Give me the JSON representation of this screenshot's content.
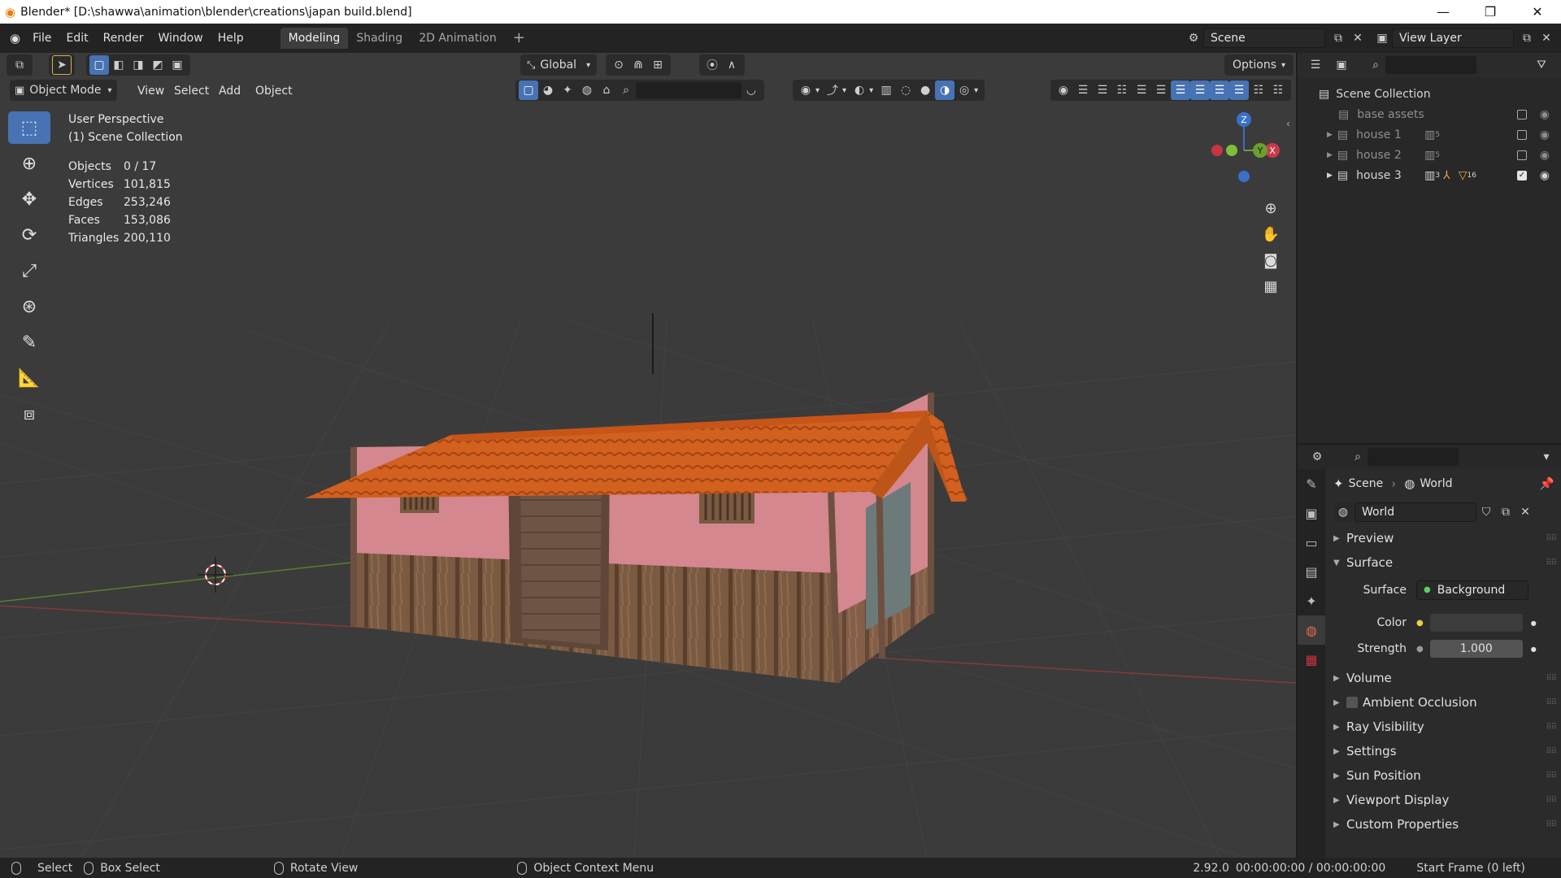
{
  "window": {
    "title": "Blender* [D:\\shawwa\\animation\\blender\\creations\\japan build.blend]",
    "minimize": "—",
    "restore": "❐",
    "close": "✕"
  },
  "menu": [
    "File",
    "Edit",
    "Render",
    "Window",
    "Help"
  ],
  "workspaces": [
    "Modeling",
    "Shading",
    "2D Animation"
  ],
  "workspace_add": "+",
  "scene_name": "Scene",
  "view_layer": "View Layer",
  "viewport": {
    "mode": "Object Mode",
    "menus": [
      "View",
      "Select",
      "Add",
      "Object"
    ],
    "transform_orientation": "Global",
    "options": "Options",
    "overlay": {
      "perspective": "User Perspective",
      "collection": "(1) Scene Collection"
    },
    "stats": [
      {
        "k": "Objects",
        "v": "0 / 17"
      },
      {
        "k": "Vertices",
        "v": "101,815"
      },
      {
        "k": "Edges",
        "v": "253,246"
      },
      {
        "k": "Faces",
        "v": "153,086"
      },
      {
        "k": "Triangles",
        "v": "200,110"
      }
    ],
    "gizmo": {
      "z": "Z",
      "x": "X",
      "y": "Y"
    }
  },
  "outliner": {
    "root": "Scene Collection",
    "items": [
      {
        "label": "base assets",
        "badge": "",
        "checked": false,
        "dim": true
      },
      {
        "label": "house 1",
        "badge": "5",
        "checked": false,
        "dim": true
      },
      {
        "label": "house 2",
        "badge": "5",
        "checked": false,
        "dim": true
      },
      {
        "label": "house 3",
        "badge": "3",
        "badge2": "16",
        "checked": true,
        "dim": false
      }
    ]
  },
  "properties": {
    "breadcrumb_scene": "Scene",
    "breadcrumb_world": "World",
    "world_name": "World",
    "panels_top": [
      "Preview",
      "Surface"
    ],
    "surface_label": "Surface",
    "surface_value": "Background",
    "color_label": "Color",
    "strength_label": "Strength",
    "strength_value": "1.000",
    "panels_bottom": [
      "Volume",
      "Ambient Occlusion",
      "Ray Visibility",
      "Settings",
      "Sun Position",
      "Viewport Display",
      "Custom Properties"
    ]
  },
  "status": {
    "select": "Select",
    "box_select": "Box Select",
    "rotate": "Rotate View",
    "context_menu": "Object Context Menu",
    "version": "2.92.0",
    "time": "00:00:00:00 / 00:00:00:00",
    "start_frame": "Start Frame (0 left)"
  },
  "colors": {
    "accent": "#4772b3",
    "world_tab": "#e86b4a",
    "roof": "#d2601f",
    "wall": "#d4878e",
    "wood": "#7a5a40"
  }
}
